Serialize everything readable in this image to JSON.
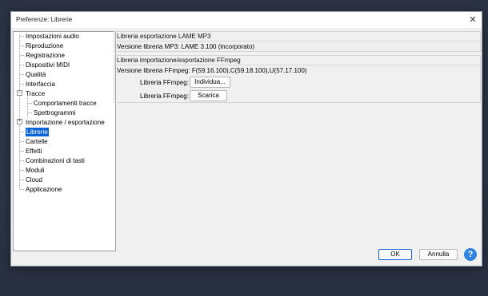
{
  "window": {
    "title": "Preferenze: Librerie",
    "close_glyph": "✕"
  },
  "tree": {
    "items": [
      {
        "label": "Impostazioni audio"
      },
      {
        "label": "Riproduzione"
      },
      {
        "label": "Registrazione"
      },
      {
        "label": "Dispositivi MIDI"
      },
      {
        "label": "Qualità"
      },
      {
        "label": "Interfaccia"
      },
      {
        "label": "Tracce",
        "expanded": true
      },
      {
        "label": "Comportamenti tracce",
        "child": true
      },
      {
        "label": "Spettrogrammi",
        "child": true
      },
      {
        "label": "Importazione / esportazione",
        "expanded": false
      },
      {
        "label": "Librerie",
        "selected": true
      },
      {
        "label": "Cartelle"
      },
      {
        "label": "Effetti"
      },
      {
        "label": "Combinazioni di tasti"
      },
      {
        "label": "Moduli"
      },
      {
        "label": "Cloud"
      },
      {
        "label": "Applicazione"
      }
    ],
    "expanded_glyph": "−",
    "collapsed_glyph": "+"
  },
  "lame": {
    "title": "Libreria esportazione LAME MP3",
    "version_text": "Versione libreria MP3: LAME 3.100 (incorporato)"
  },
  "ffmpeg": {
    "title": "Libreria importazione/esportazione FFmpeg",
    "version_text": "Versione libreria FFmpeg: F(59.16.100),C(59.18.100),U(57.17.100)",
    "locate_label": "Libreria FFmpeg:",
    "locate_button": "Individua...",
    "download_label": "Libreria FFmpeg:",
    "download_button": "Scarica"
  },
  "footer": {
    "ok_button": "OK",
    "cancel_button": "Annulla",
    "help_glyph": "?"
  },
  "colors": {
    "selection": "#0a64d8",
    "help_button": "#2e84e0"
  }
}
